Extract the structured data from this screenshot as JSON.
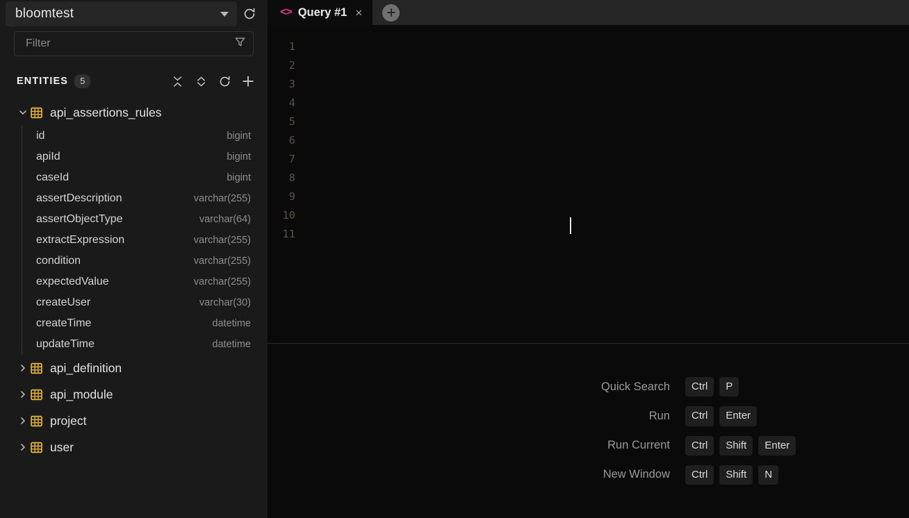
{
  "sidebar": {
    "database": {
      "name": "bloomtest",
      "dropdown_icon": "chevron-down-icon",
      "refresh_icon": "refresh-icon"
    },
    "filter": {
      "placeholder": "Filter",
      "value": "",
      "icon": "funnel-icon"
    },
    "entities": {
      "title": "ENTITIES",
      "count": "5",
      "tools": [
        "collapse-all-icon",
        "expand-all-icon",
        "refresh-icon",
        "add-icon"
      ]
    },
    "tree": [
      {
        "name": "api_assertions_rules",
        "expanded": true,
        "columns": [
          {
            "name": "id",
            "type": "bigint"
          },
          {
            "name": "apiId",
            "type": "bigint"
          },
          {
            "name": "caseId",
            "type": "bigint"
          },
          {
            "name": "assertDescription",
            "type": "varchar(255)"
          },
          {
            "name": "assertObjectType",
            "type": "varchar(64)"
          },
          {
            "name": "extractExpression",
            "type": "varchar(255)"
          },
          {
            "name": "condition",
            "type": "varchar(255)"
          },
          {
            "name": "expectedValue",
            "type": "varchar(255)"
          },
          {
            "name": "createUser",
            "type": "varchar(30)"
          },
          {
            "name": "createTime",
            "type": "datetime"
          },
          {
            "name": "updateTime",
            "type": "datetime"
          }
        ]
      },
      {
        "name": "api_definition",
        "expanded": false,
        "columns": []
      },
      {
        "name": "api_module",
        "expanded": false,
        "columns": []
      },
      {
        "name": "project",
        "expanded": false,
        "columns": []
      },
      {
        "name": "user",
        "expanded": false,
        "columns": []
      }
    ]
  },
  "main": {
    "tab": {
      "label": "Query #1",
      "code_icon": "<>",
      "close_icon": "×"
    },
    "new_tab_icon": "plus-icon",
    "editor": {
      "line_numbers": [
        "1",
        "2",
        "3",
        "4",
        "5",
        "6",
        "7",
        "8",
        "9",
        "10",
        "11"
      ],
      "content": "",
      "cursor_line": "9"
    },
    "shortcuts": [
      {
        "label": "Quick Search",
        "keys": [
          "Ctrl",
          "P"
        ]
      },
      {
        "label": "Run",
        "keys": [
          "Ctrl",
          "Enter"
        ]
      },
      {
        "label": "Run Current",
        "keys": [
          "Ctrl",
          "Shift",
          "Enter"
        ]
      },
      {
        "label": "New Window",
        "keys": [
          "Ctrl",
          "Shift",
          "N"
        ]
      }
    ]
  },
  "colors": {
    "table_icon": "#e8b830",
    "tab_accent": "#e8369c",
    "sidebar_bg": "#1a1a1a",
    "editor_bg": "#0a0a0a"
  }
}
